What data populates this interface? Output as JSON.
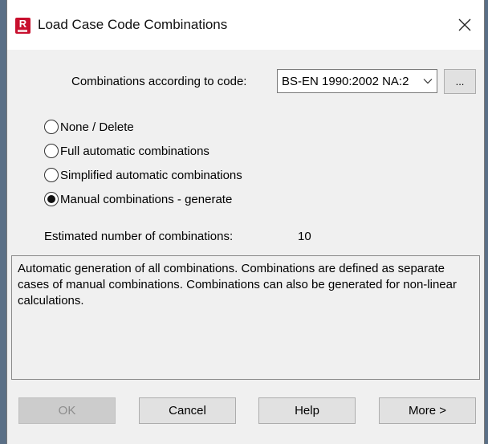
{
  "window": {
    "title": "Load Case Code Combinations",
    "app_icon_letter": "R"
  },
  "code": {
    "label": "Combinations according to code:",
    "selected": "BS-EN 1990:2002 NA:2",
    "browse_label": "..."
  },
  "combination_modes": [
    {
      "label": "None / Delete",
      "checked": false
    },
    {
      "label": "Full automatic combinations",
      "checked": false
    },
    {
      "label": "Simplified automatic combinations",
      "checked": false
    },
    {
      "label": "Manual combinations - generate",
      "checked": true
    }
  ],
  "estimate": {
    "label": "Estimated number of combinations:",
    "value": "10"
  },
  "description": "Automatic generation of all combinations. Combinations are defined as separate cases of manual combinations. Combinations can also be generated for non-linear calculations.",
  "buttons": {
    "ok": "OK",
    "cancel": "Cancel",
    "help": "Help",
    "more": "More >"
  },
  "colors": {
    "app_icon": "#c8102e",
    "dialog_bg": "#f0f0f0",
    "button_bg": "#e1e1e1",
    "disabled_text": "#8d8d8d"
  }
}
